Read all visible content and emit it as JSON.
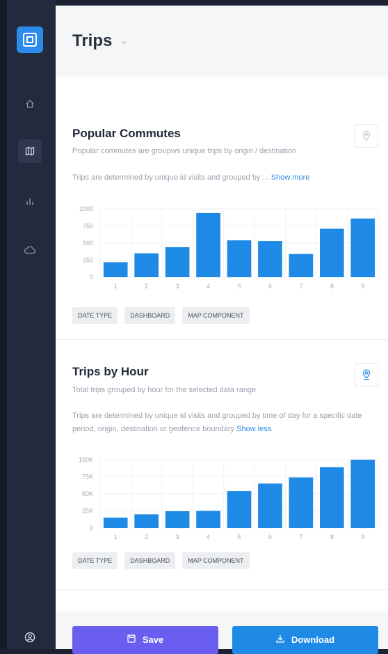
{
  "header": {
    "title": "Trips"
  },
  "sidebar": {
    "items": [
      {
        "name": "home",
        "icon": "home-icon"
      },
      {
        "name": "map",
        "icon": "map-icon",
        "active": true
      },
      {
        "name": "analytics",
        "icon": "bar-chart-icon"
      },
      {
        "name": "cloud",
        "icon": "cloud-icon"
      }
    ],
    "user_icon": "user-circle-icon"
  },
  "sections": [
    {
      "title": "Popular Commutes",
      "subtitle": "Popular commutes are groupws unique trips by origin / destination",
      "description": "Trips are determined by unique id visits and grouped by ...",
      "link": "Show more",
      "tags": [
        "DATE TYPE",
        "DASHBOARD",
        "MAP COMPONENT"
      ]
    },
    {
      "title": "Trips by Hour",
      "subtitle": "Total trips grouped by hour for the selected data range",
      "description": "Trips are determined by unique id visits and grouped by time of day for a specific date period, origin, destination or geofence boundary",
      "link": "Show less",
      "tags": [
        "DATE TYPE",
        "DASHBOARD",
        "MAP COMPONENT"
      ]
    }
  ],
  "chart_data": [
    {
      "type": "bar",
      "categories": [
        "1",
        "2",
        "3",
        "4",
        "5",
        "6",
        "7",
        "8",
        "9"
      ],
      "values": [
        220,
        350,
        440,
        940,
        540,
        530,
        340,
        710,
        860
      ],
      "yticks": [
        "1000",
        "750",
        "500",
        "250",
        "0"
      ],
      "ylim": [
        0,
        1000
      ],
      "color": "#1f8ae6"
    },
    {
      "type": "bar",
      "categories": [
        "1",
        "2",
        "3",
        "4",
        "5",
        "6",
        "7",
        "8",
        "9"
      ],
      "values": [
        15000,
        20000,
        24500,
        25000,
        54000,
        65000,
        74000,
        89000,
        100000
      ],
      "yticks": [
        "100K",
        "75K",
        "50K",
        "25K",
        "0"
      ],
      "ylim": [
        0,
        100000
      ],
      "color": "#1f8ae6"
    }
  ],
  "actions": {
    "save_label": "Save",
    "download_label": "Download"
  },
  "colors": {
    "accent": "#2a8bea",
    "save": "#6a5ef0",
    "download": "#1f8ae6",
    "sidebar": "#222a3d"
  }
}
